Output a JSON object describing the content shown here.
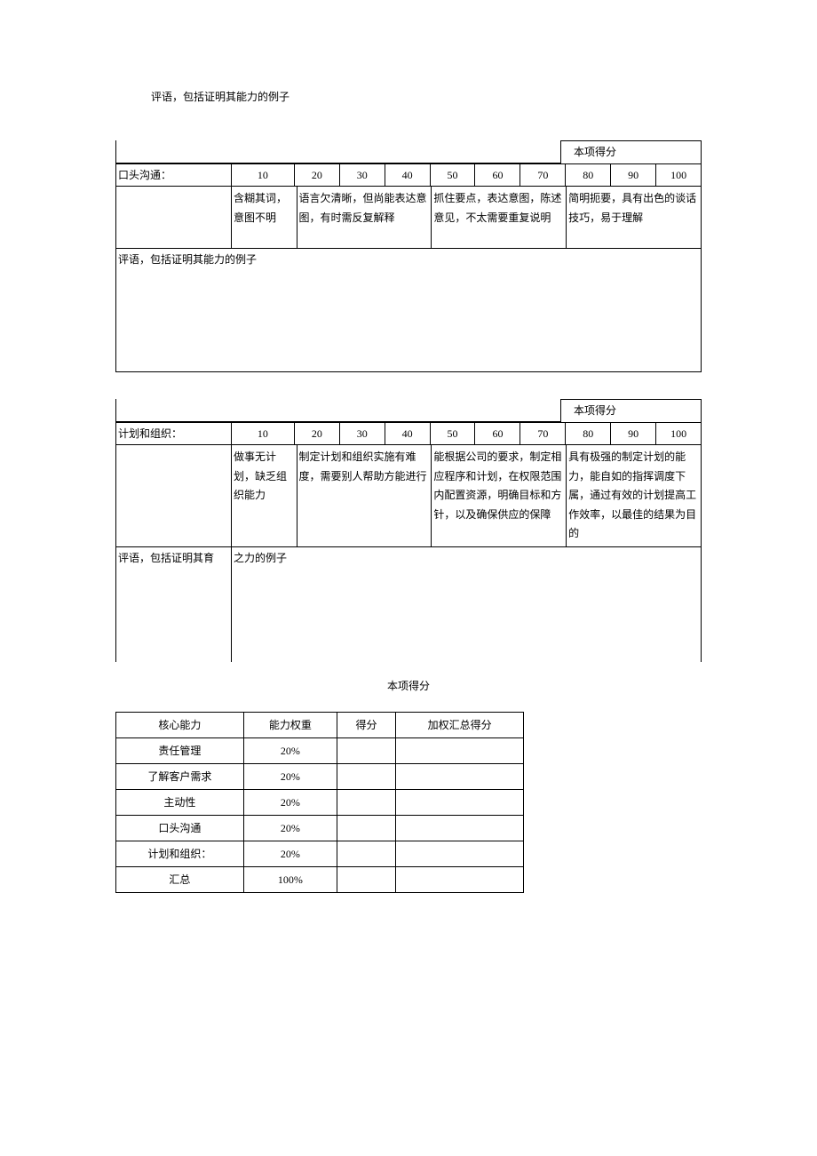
{
  "intro": "评语，包括证明其能力的例子",
  "score_header": "本项得分",
  "scale": [
    "10",
    "20",
    "30",
    "40",
    "50",
    "60",
    "70",
    "80",
    "90",
    "100"
  ],
  "rubrics": [
    {
      "title": "口头沟通：",
      "descs": [
        "含糊其词，意图不明",
        "语言欠清晰，但尚能表达意图，有时需反复解释",
        "抓住要点，表达意图，陈述意见，不太需要重复说明",
        "简明扼要，具有出色的谈话技巧，易于理解"
      ],
      "comment_label": "评语，包括证明其能力的例子",
      "comment_split": false
    },
    {
      "title": "计划和组织：",
      "descs": [
        "做事无计划，缺乏组织能力",
        "制定计划和组织实施有难度，需要别人帮助方能进行",
        "能根据公司的要求，制定相应程序和计划，在权限范围内配置资源，明确目标和方针，以及确保供应的保障",
        "具有极强的制定计划的能力，能自如的指挥调度下属，通过有效的计划提高工作效率，以最佳的结果为目的"
      ],
      "comment_label": "评语，包括证明其育",
      "comment_label2": "之力的例子",
      "comment_split": true
    }
  ],
  "summary": {
    "headers": [
      "核心能力",
      "能力权重",
      "得分",
      "加权汇总得分"
    ],
    "rows": [
      [
        "责任管理",
        "20%",
        "",
        ""
      ],
      [
        "了解客户需求",
        "20%",
        "",
        ""
      ],
      [
        "主动性",
        "20%",
        "",
        ""
      ],
      [
        "口头沟通",
        "20%",
        "",
        ""
      ],
      [
        "计划和组织：",
        "20%",
        "",
        ""
      ],
      [
        "汇总",
        "100%",
        "",
        ""
      ]
    ]
  }
}
